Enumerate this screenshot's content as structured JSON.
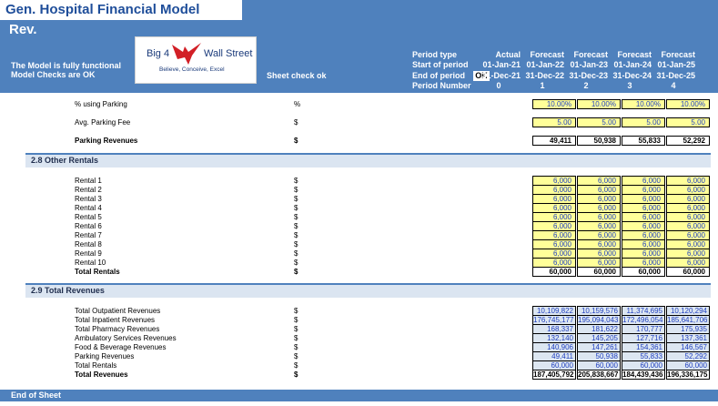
{
  "header": {
    "title": "Gen. Hospital Financial Model",
    "subtitle": "Rev.",
    "note1": "The Model is fully functional",
    "note2": "Model Checks are OK",
    "sheet_check": "Sheet check ok",
    "logo": {
      "left": "Big 4",
      "right": "Wall Street",
      "tagline": "Believe, Conceive, Excel"
    },
    "ok_badge": "OK",
    "row_labels": [
      "Period type",
      "Start of period",
      "End of period",
      "Period Number"
    ],
    "columns": [
      {
        "type": "Actual",
        "start": "01-Jan-21",
        "end": "31-Dec-21",
        "num": "0"
      },
      {
        "type": "Forecast",
        "start": "01-Jan-22",
        "end": "31-Dec-22",
        "num": "1"
      },
      {
        "type": "Forecast",
        "start": "01-Jan-23",
        "end": "31-Dec-23",
        "num": "2"
      },
      {
        "type": "Forecast",
        "start": "01-Jan-24",
        "end": "31-Dec-24",
        "num": "3"
      },
      {
        "type": "Forecast",
        "start": "01-Jan-25",
        "end": "31-Dec-25",
        "num": "4"
      }
    ]
  },
  "parking": {
    "using": {
      "label": "% using Parking",
      "unit": "%",
      "values": [
        "10.00%",
        "10.00%",
        "10.00%",
        "10.00%"
      ]
    },
    "fee": {
      "label": "Avg. Parking Fee",
      "unit": "$",
      "values": [
        "5.00",
        "5.00",
        "5.00",
        "5.00"
      ]
    },
    "revenues": {
      "label": "Parking Revenues",
      "unit": "$",
      "values": [
        "49,411",
        "50,938",
        "55,833",
        "52,292"
      ]
    }
  },
  "rentals": {
    "section": "2.8   Other Rentals",
    "unit": "$",
    "rows": [
      {
        "label": "Rental 1",
        "values": [
          "6,000",
          "6,000",
          "6,000",
          "6,000"
        ]
      },
      {
        "label": "Rental 2",
        "values": [
          "6,000",
          "6,000",
          "6,000",
          "6,000"
        ]
      },
      {
        "label": "Rental 3",
        "values": [
          "6,000",
          "6,000",
          "6,000",
          "6,000"
        ]
      },
      {
        "label": "Rental 4",
        "values": [
          "6,000",
          "6,000",
          "6,000",
          "6,000"
        ]
      },
      {
        "label": "Rental 5",
        "values": [
          "6,000",
          "6,000",
          "6,000",
          "6,000"
        ]
      },
      {
        "label": "Rental 6",
        "values": [
          "6,000",
          "6,000",
          "6,000",
          "6,000"
        ]
      },
      {
        "label": "Rental 7",
        "values": [
          "6,000",
          "6,000",
          "6,000",
          "6,000"
        ]
      },
      {
        "label": "Rental 8",
        "values": [
          "6,000",
          "6,000",
          "6,000",
          "6,000"
        ]
      },
      {
        "label": "Rental 9",
        "values": [
          "6,000",
          "6,000",
          "6,000",
          "6,000"
        ]
      },
      {
        "label": "Rental 10",
        "values": [
          "6,000",
          "6,000",
          "6,000",
          "6,000"
        ]
      }
    ],
    "total": {
      "label": "Total Rentals",
      "values": [
        "60,000",
        "60,000",
        "60,000",
        "60,000"
      ]
    }
  },
  "totals": {
    "section": "2.9   Total Revenues",
    "unit": "$",
    "rows": [
      {
        "label": "Total Outpatient Revenues",
        "values": [
          "10,109,822",
          "10,159,576",
          "11,374,695",
          "10,120,294"
        ]
      },
      {
        "label": "Total Inpatient Revenues",
        "values": [
          "176,745,177",
          "195,094,043",
          "172,496,054",
          "185,641,706"
        ]
      },
      {
        "label": "Total Pharmacy Revenues",
        "values": [
          "168,337",
          "181,622",
          "170,777",
          "175,935"
        ]
      },
      {
        "label": "Ambulatory Services Revenues",
        "values": [
          "132,140",
          "145,205",
          "127,716",
          "137,361"
        ]
      },
      {
        "label": "Food & Beverage Revenues",
        "values": [
          "140,906",
          "147,261",
          "154,361",
          "146,567"
        ]
      },
      {
        "label": "Parking Revenues",
        "values": [
          "49,411",
          "50,938",
          "55,833",
          "52,292"
        ]
      },
      {
        "label": "Total Rentals",
        "values": [
          "60,000",
          "60,000",
          "60,000",
          "60,000"
        ]
      }
    ],
    "total": {
      "label": "Total Revenues",
      "values": [
        "187,405,792",
        "205,838,667",
        "184,439,436",
        "196,336,175"
      ]
    }
  },
  "footer": {
    "label": "End of Sheet"
  }
}
